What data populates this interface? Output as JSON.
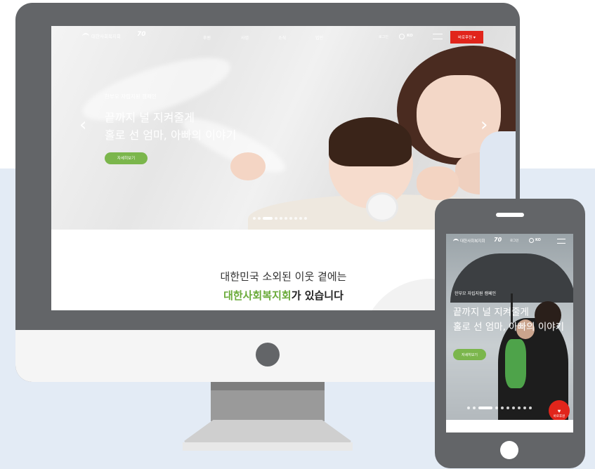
{
  "colors": {
    "background_band": "#e3ebf5",
    "device_body": "#636568",
    "donate_red": "#e1251b",
    "brand_green": "#6bab3b",
    "button_green": "#7bb64c"
  },
  "desktop": {
    "nav": {
      "logo_text": "대한사회복지회",
      "anniversary_mark": "70",
      "menu": [
        "후원",
        "사업",
        "소식",
        "법인"
      ],
      "small_link": "로그인",
      "language": "KO",
      "donate_label": "바로후원 ♥"
    },
    "hero": {
      "campaign_label": "한부모 자립지원 캠페인",
      "headline_line1": "끝까지 널 지켜줄게",
      "headline_line2": "홀로 선 엄마, 아빠의 이야기",
      "cta_label": "자세히보기",
      "prev_icon": "chevron-left-icon",
      "next_icon": "chevron-right-icon",
      "slide_count": 10,
      "active_slide": 3
    },
    "tagline": {
      "line1": "대한민국 소외된 이웃 곁에는",
      "brand": "대한사회복지회",
      "rest": "가 있습니다"
    }
  },
  "mobile": {
    "nav": {
      "logo_text": "대한사회복지회",
      "anniversary_mark": "70",
      "small_link": "로그인",
      "language": "KO"
    },
    "hero": {
      "campaign_label": "한부모 자립지원 캠페인",
      "headline_line1": "끝까지 널 지켜줄게",
      "headline_line2": "홀로 선 엄마, 아빠의 이야기",
      "cta_label": "자세히보기",
      "slide_count": 10,
      "active_slide": 3
    },
    "floating_donate": {
      "icon": "heart-icon",
      "label": "바로후원"
    }
  }
}
